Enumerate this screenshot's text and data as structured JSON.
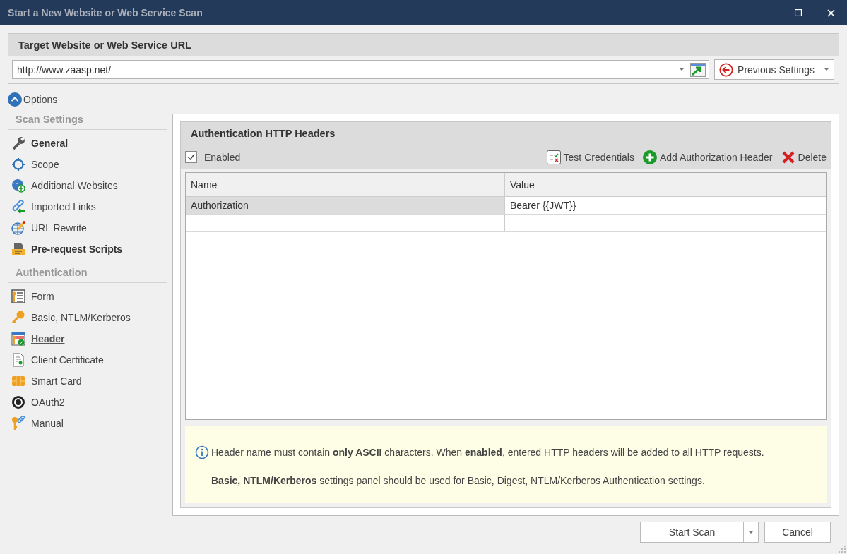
{
  "window": {
    "title": "Start a New Website or Web Service Scan"
  },
  "target": {
    "title": "Target Website or Web Service URL",
    "url": "http://www.zaasp.net/",
    "previous_button": "Previous Settings"
  },
  "options": {
    "label": "Options",
    "expanded": true
  },
  "sidebar": [
    {
      "heading": "Scan Settings",
      "items": [
        {
          "label": "General",
          "bold": true,
          "selected": false
        },
        {
          "label": "Scope",
          "bold": false,
          "selected": false
        },
        {
          "label": "Additional Websites",
          "bold": false,
          "selected": false
        },
        {
          "label": "Imported Links",
          "bold": false,
          "selected": false
        },
        {
          "label": "URL Rewrite",
          "bold": false,
          "selected": false
        },
        {
          "label": "Pre-request Scripts",
          "bold": true,
          "selected": false
        }
      ]
    },
    {
      "heading": "Authentication",
      "items": [
        {
          "label": "Form",
          "bold": false,
          "selected": false
        },
        {
          "label": "Basic, NTLM/Kerberos",
          "bold": false,
          "selected": false
        },
        {
          "label": "Header",
          "bold": true,
          "selected": true
        },
        {
          "label": "Client Certificate",
          "bold": false,
          "selected": false
        },
        {
          "label": "Smart Card",
          "bold": false,
          "selected": false
        },
        {
          "label": "OAuth2",
          "bold": false,
          "selected": false
        },
        {
          "label": "Manual",
          "bold": false,
          "selected": false
        }
      ]
    }
  ],
  "panel": {
    "title": "Authentication HTTP Headers",
    "enabled": {
      "label": "Enabled",
      "checked": true
    },
    "toolbar": [
      "Test Credentials",
      "Add Authorization Header",
      "Delete"
    ],
    "table": {
      "columns": [
        "Name",
        "Value"
      ],
      "rows": [
        {
          "name": "Authorization",
          "value": "Bearer {{JWT}}",
          "selected": true
        }
      ]
    },
    "info": [
      "Header name must contain **only ASCII** characters. When **enabled**, entered HTTP headers will be added to all HTTP requests.",
      "**Basic, NTLM/Kerberos** settings panel should be used for Basic, Digest, NTLM/Kerberos Authentication settings."
    ]
  },
  "buttons": {
    "start": "Start Scan",
    "cancel": "Cancel"
  }
}
